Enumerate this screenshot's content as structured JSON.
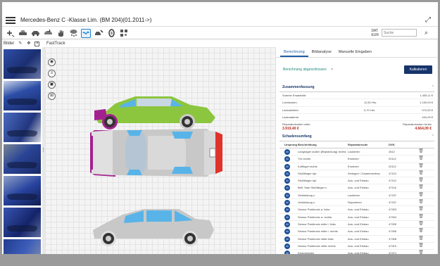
{
  "window": {
    "title": "Mercedes-Benz C -Klasse Lim. (BM 204)(01.2011->)"
  },
  "toolbar": {
    "search_placeholder": "Suche",
    "date_text": "DAT\nEUR"
  },
  "panel": {
    "bilder_label": "Bilder",
    "fasttrack_label": "FastTrack"
  },
  "right_panel": {
    "tabs": [
      {
        "label": "Berechnung"
      },
      {
        "label": "Bildanalyse"
      },
      {
        "label": "Manuelle Eingaben"
      }
    ],
    "status": "Berechnung abgeschlossen",
    "calc_button": "Kalkulieren",
    "summary": {
      "title": "Zusammenfassung",
      "rows": [
        {
          "label": "Summe Ersatzteile",
          "qty": "",
          "value": "1.405,11 €"
        },
        {
          "label": "Lohnkosten",
          "qty": "11,50 Hrs.",
          "value": "1.150,00 €"
        },
        {
          "label": "Lackarbeiten",
          "qty": "0,70 Hrs.",
          "value": "070,00 €"
        },
        {
          "label": "Lackmaterial",
          "qty": "",
          "value": "494,29 €"
        }
      ],
      "net_label": "Reparaturkosten netto",
      "gross_label": "Reparaturkosten brutto",
      "net_value": "3.919,40 €",
      "gross_value": "4.664,09 €"
    },
    "damage": {
      "title": "Schadensumfang",
      "headers": [
        "Ursprung",
        "Beschreibung",
        "Reparaturcode",
        "DVN"
      ],
      "rows": [
        {
          "badge": "AI",
          "desc": "Langeager außen (Beplankung) rechts",
          "code": "Lackieren",
          "dvn": "4512"
        },
        {
          "badge": "AI",
          "desc": "Tür rechts",
          "code": "Ersetzen",
          "dvn": "20112"
        },
        {
          "badge": "AI",
          "desc": "Kotflügel rechts",
          "code": "Ersetzen",
          "dvn": "20112"
        },
        {
          "badge": "AI",
          "desc": "Stoßfänger kpl.",
          "code": "Zerlegen / Zusammenbau",
          "dvn": "47110"
        },
        {
          "badge": "AI",
          "desc": "Stoßfänger kpl.",
          "code": "Aus- und Einbau",
          "dvn": "47110"
        },
        {
          "badge": "AI",
          "desc": "Befl. Satz Stoßfänger v.",
          "code": "Aus- und Einbau",
          "dvn": "47116"
        },
        {
          "badge": "AI",
          "desc": "Verkleidung v.",
          "code": "Lackieren",
          "dvn": "47157"
        },
        {
          "badge": "AI",
          "desc": "Verkleidung v.",
          "code": "Reparieren",
          "dvn": "47157"
        },
        {
          "badge": "AI",
          "desc": "Sensor Parktronic a. links",
          "code": "Aus- und Einbau",
          "dvn": "47303"
        },
        {
          "badge": "AI",
          "desc": "Sensor Parktronic a. rechts",
          "code": "Aus- und Einbau",
          "dvn": "47304"
        },
        {
          "badge": "AI",
          "desc": "Sensor Parktronic mitte i. links",
          "code": "Aus- und Einbau",
          "dvn": "47305"
        },
        {
          "badge": "AI",
          "desc": "Sensor Parktronic mitte i. rechts",
          "code": "Aus- und Einbau",
          "dvn": "47306"
        },
        {
          "badge": "AI",
          "desc": "Sensor Parktronic mitte links",
          "code": "Aus- und Einbau",
          "dvn": "47308"
        },
        {
          "badge": "AI",
          "desc": "Sensor Parktronic mitte rechts",
          "code": "Aus- und Einbau",
          "dvn": "47310"
        },
        {
          "badge": "AI",
          "desc": "Kennzeichen",
          "code": "Aus- und Einbau",
          "dvn": "47371"
        }
      ]
    }
  },
  "colors": {
    "accent": "#1e5ca8",
    "button": "#17346b",
    "status": "#1c8a7a",
    "total": "#b52a1f",
    "damage_magenta": "#a3208f",
    "damage_green": "#8cc63f",
    "damage_red": "#e0332b"
  }
}
